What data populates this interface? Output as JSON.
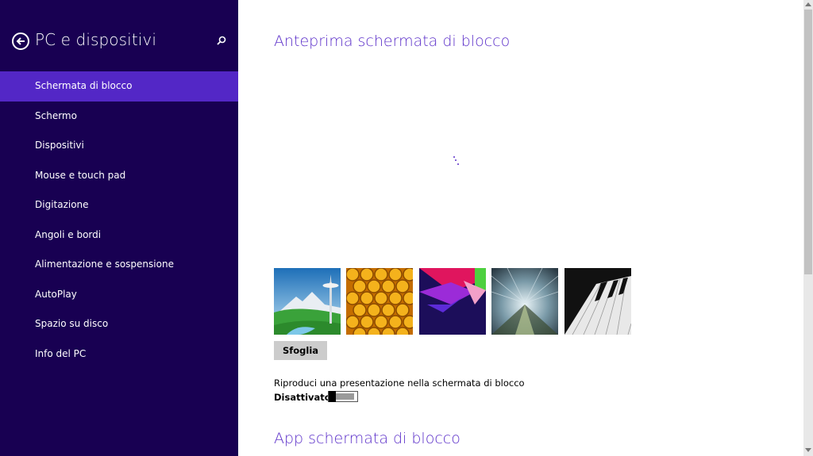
{
  "sidebar": {
    "title": "PC e dispositivi",
    "items": [
      {
        "label": "Schermata di blocco",
        "selected": true
      },
      {
        "label": "Schermo"
      },
      {
        "label": "Dispositivi"
      },
      {
        "label": "Mouse e touch pad"
      },
      {
        "label": "Digitazione"
      },
      {
        "label": "Angoli e bordi"
      },
      {
        "label": "Alimentazione e sospensione"
      },
      {
        "label": "AutoPlay"
      },
      {
        "label": "Spazio su disco"
      },
      {
        "label": "Info del PC"
      }
    ]
  },
  "main": {
    "preview_title": "Anteprima schermata di blocco",
    "thumbnails": [
      {
        "name": "space-needle"
      },
      {
        "name": "honeycomb"
      },
      {
        "name": "geometric-shapes"
      },
      {
        "name": "tunnel"
      },
      {
        "name": "piano"
      }
    ],
    "browse_label": "Sfoglia",
    "slideshow_label": "Riproduci una presentazione nella schermata di blocco",
    "slideshow_state": "Disattivato",
    "slideshow_on": false,
    "apps_title": "App schermata di blocco"
  },
  "colors": {
    "sidebar_bg": "#180052",
    "selected_bg": "#5327c6",
    "accent": "#5b2fc9"
  }
}
